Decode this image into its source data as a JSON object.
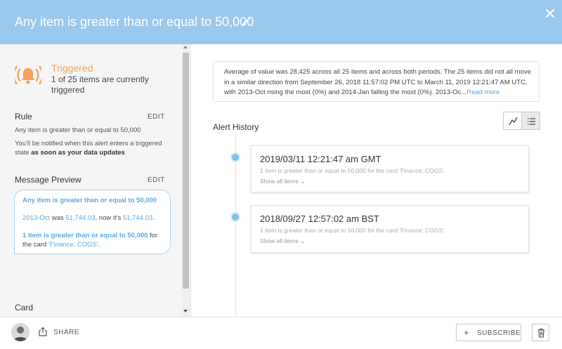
{
  "header": {
    "title": "Any item is greater than or equal to 50,000",
    "bg_color": "#99c8ec"
  },
  "status": {
    "title": "Triggered",
    "description": "1 of 25 items are currently triggered",
    "color": "#f4a35b"
  },
  "rule": {
    "heading": "Rule",
    "edit_label": "EDIT",
    "condition": "Any item is greater than or equal to 50,000",
    "notify_prefix": "You'll be notified when this alert enters a triggered state ",
    "notify_bold": "as soon as your data updates"
  },
  "message_preview": {
    "heading": "Message Preview",
    "edit_label": "EDIT",
    "line1": "Any item is greater than or equal to 50,000",
    "line2_item": "2013-Oct",
    "line2_was": " was ",
    "line2_value1": "51,744.03",
    "line2_now": ", now it's ",
    "line2_value2": "51,744.03",
    "line2_end": ".",
    "line3_bold": "1 item is greater than or equal to 50,000",
    "line3_for": " for",
    "line4_prefix": "the card ",
    "line4_card": "'Finance: COGS'",
    "line4_end": "."
  },
  "card_section": {
    "heading": "Card"
  },
  "summary": {
    "text": "Average of value was 28,425 across all 25 items and across both periods. The 25 items did not all move in a similar direction from September 26, 2018 11:57:02 PM UTC to March 11, 2019 12:21:47 AM UTC, with 2013-Oct rising the most (0%) and 2014-Jan falling the most (0%). 2013-Oc...",
    "read_more": "Read more"
  },
  "alert_history": {
    "label": "Alert History",
    "entries": [
      {
        "timestamp": "2019/03/11 12:21:47 am GMT",
        "description": "1 item is greater than or equal to 50,000 for the card 'Finance: COGS'.",
        "show_items": "Show all items"
      },
      {
        "timestamp": "2018/09/27 12:57:02 am BST",
        "description": "1 item is greater than or equal to 50,000 for the card 'Finance: COGS'.",
        "show_items": "Show all items"
      }
    ]
  },
  "footer": {
    "share_label": "SHARE",
    "subscribe_label": "SUBSCRIBE",
    "subscribe_icon": "+"
  },
  "icons": {
    "edit": "pencil-icon",
    "close": "close-icon",
    "status": "bell-icon",
    "chart_view": "line-chart-icon",
    "list_view": "list-icon",
    "share": "share-icon",
    "delete": "trash-icon",
    "expand": "chevron-down-icon"
  }
}
